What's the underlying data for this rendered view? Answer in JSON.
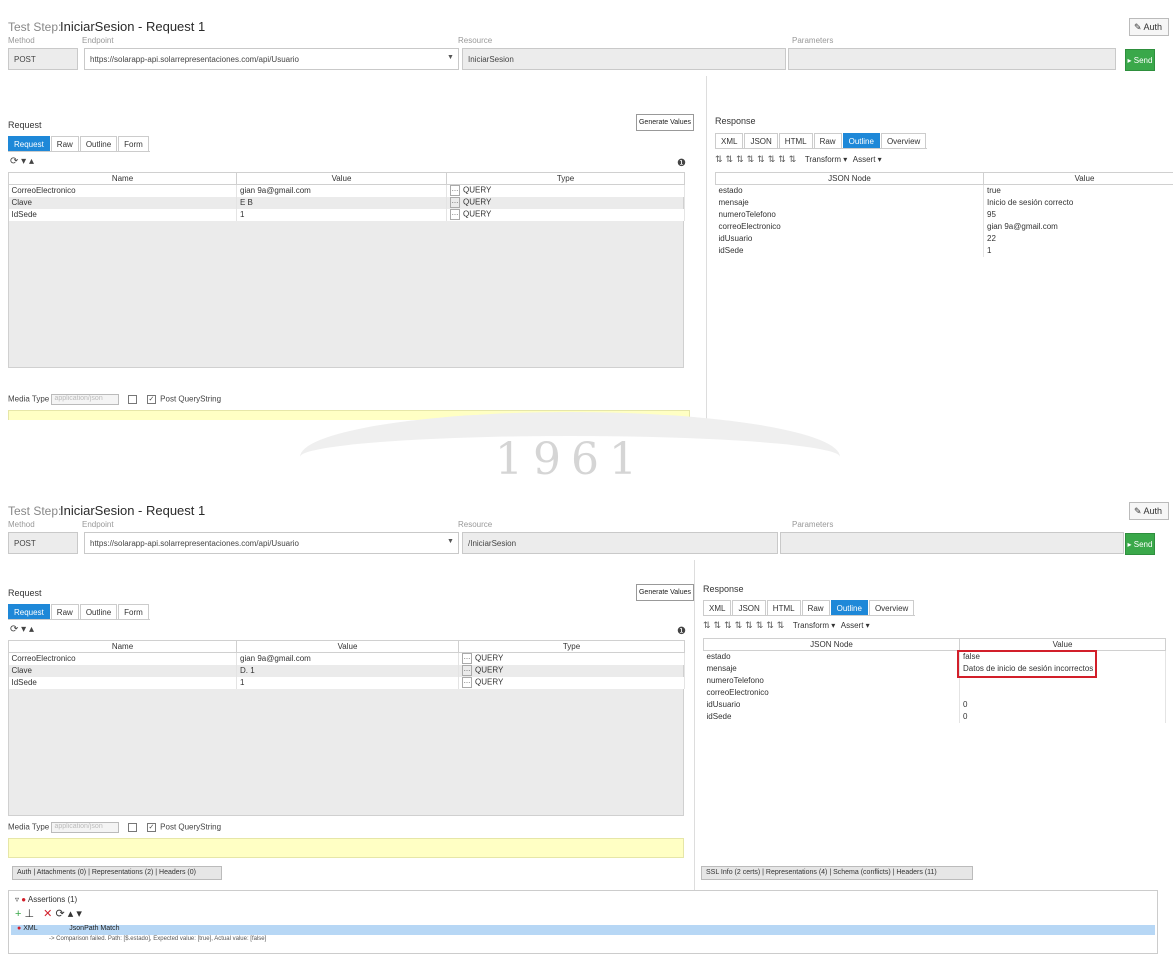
{
  "panels": [
    {
      "step_prefix": "Test Step:",
      "step_title": "IniciarSesion - Request 1",
      "auth_label": "Auth",
      "labels": {
        "method": "Method",
        "endpoint": "Endpoint",
        "resource": "Resource",
        "parameters": "Parameters"
      },
      "method": "POST",
      "endpoint": "https://solarapp-api.solarrepresentaciones.com/api/Usuario",
      "resource": "IniciarSesion",
      "parameters": "",
      "send_label": "▸ Send",
      "request": {
        "title": "Request",
        "generate_label": "Generate Values",
        "tabs": [
          "Request",
          "Raw",
          "Outline",
          "Form"
        ],
        "columns": [
          "Name",
          "Value",
          "Type"
        ],
        "rows": [
          {
            "name": "CorreoElectronico",
            "value": "gian          9a@gmail.com",
            "type": "QUERY"
          },
          {
            "name": "Clave",
            "value": "E        B",
            "type": "QUERY"
          },
          {
            "name": "IdSede",
            "value": "1",
            "type": "QUERY"
          }
        ],
        "media_type_label": "Media Type",
        "media_type_value": "application/json",
        "post_qs_label": "Post QueryString"
      },
      "response": {
        "title": "Response",
        "tabs": [
          "XML",
          "JSON",
          "HTML",
          "Raw",
          "Outline",
          "Overview"
        ],
        "transform_label": "Transform",
        "assert_label": "Assert",
        "columns": [
          "JSON Node",
          "Value"
        ],
        "rows": [
          {
            "node": "estado",
            "value": "true"
          },
          {
            "node": "mensaje",
            "value": "Inicio de sesión correcto"
          },
          {
            "node": "numeroTelefono",
            "value": "95"
          },
          {
            "node": "correoElectronico",
            "value": "gian                  9a@gmail.com"
          },
          {
            "node": "idUsuario",
            "value": "22"
          },
          {
            "node": "idSede",
            "value": "1"
          }
        ]
      }
    },
    {
      "step_prefix": "Test Step:",
      "step_title": "IniciarSesion - Request 1",
      "auth_label": "Auth",
      "labels": {
        "method": "Method",
        "endpoint": "Endpoint",
        "resource": "Resource",
        "parameters": "Parameters"
      },
      "method": "POST",
      "endpoint": "https://solarapp-api.solarrepresentaciones.com/api/Usuario",
      "resource": "/IniciarSesion",
      "parameters": "",
      "send_label": "▸ Send",
      "request": {
        "title": "Request",
        "generate_label": "Generate Values",
        "tabs": [
          "Request",
          "Raw",
          "Outline",
          "Form"
        ],
        "columns": [
          "Name",
          "Value",
          "Type"
        ],
        "rows": [
          {
            "name": "CorreoElectronico",
            "value": "gian          9a@gmail.com",
            "type": "QUERY"
          },
          {
            "name": "Clave",
            "value": "D.       1",
            "type": "QUERY"
          },
          {
            "name": "IdSede",
            "value": "1",
            "type": "QUERY"
          }
        ],
        "media_type_label": "Media Type",
        "media_type_value": "application/json",
        "post_qs_label": "Post QueryString",
        "bottom_tabs": "Auth | Attachments (0) | Representations (2) | Headers (0)"
      },
      "response": {
        "title": "Response",
        "tabs": [
          "XML",
          "JSON",
          "HTML",
          "Raw",
          "Outline",
          "Overview"
        ],
        "transform_label": "Transform",
        "assert_label": "Assert",
        "columns": [
          "JSON Node",
          "Value"
        ],
        "rows": [
          {
            "node": "estado",
            "value": "false"
          },
          {
            "node": "mensaje",
            "value": "Datos de inicio de sesión incorrectos"
          },
          {
            "node": "numeroTelefono",
            "value": ""
          },
          {
            "node": "correoElectronico",
            "value": ""
          },
          {
            "node": "idUsuario",
            "value": "0"
          },
          {
            "node": "idSede",
            "value": "0"
          }
        ],
        "bottom_tabs": "SSL Info (2 certs) | Representations (4) | Schema (conflicts) | Headers (11)"
      },
      "assertions": {
        "title": "Assertions (1)",
        "row_type": "XML",
        "row_name": "JsonPath Match",
        "detail": "-> Comparison failed. Path: [$.estado], Expected value: [true], Actual value: [false]"
      }
    }
  ],
  "watermark": "1961",
  "colors": {
    "send": "#3aa84a",
    "active_tab": "#1e88d8",
    "highlight": "#d21f2a",
    "assert_row": "#b7d7f5"
  }
}
